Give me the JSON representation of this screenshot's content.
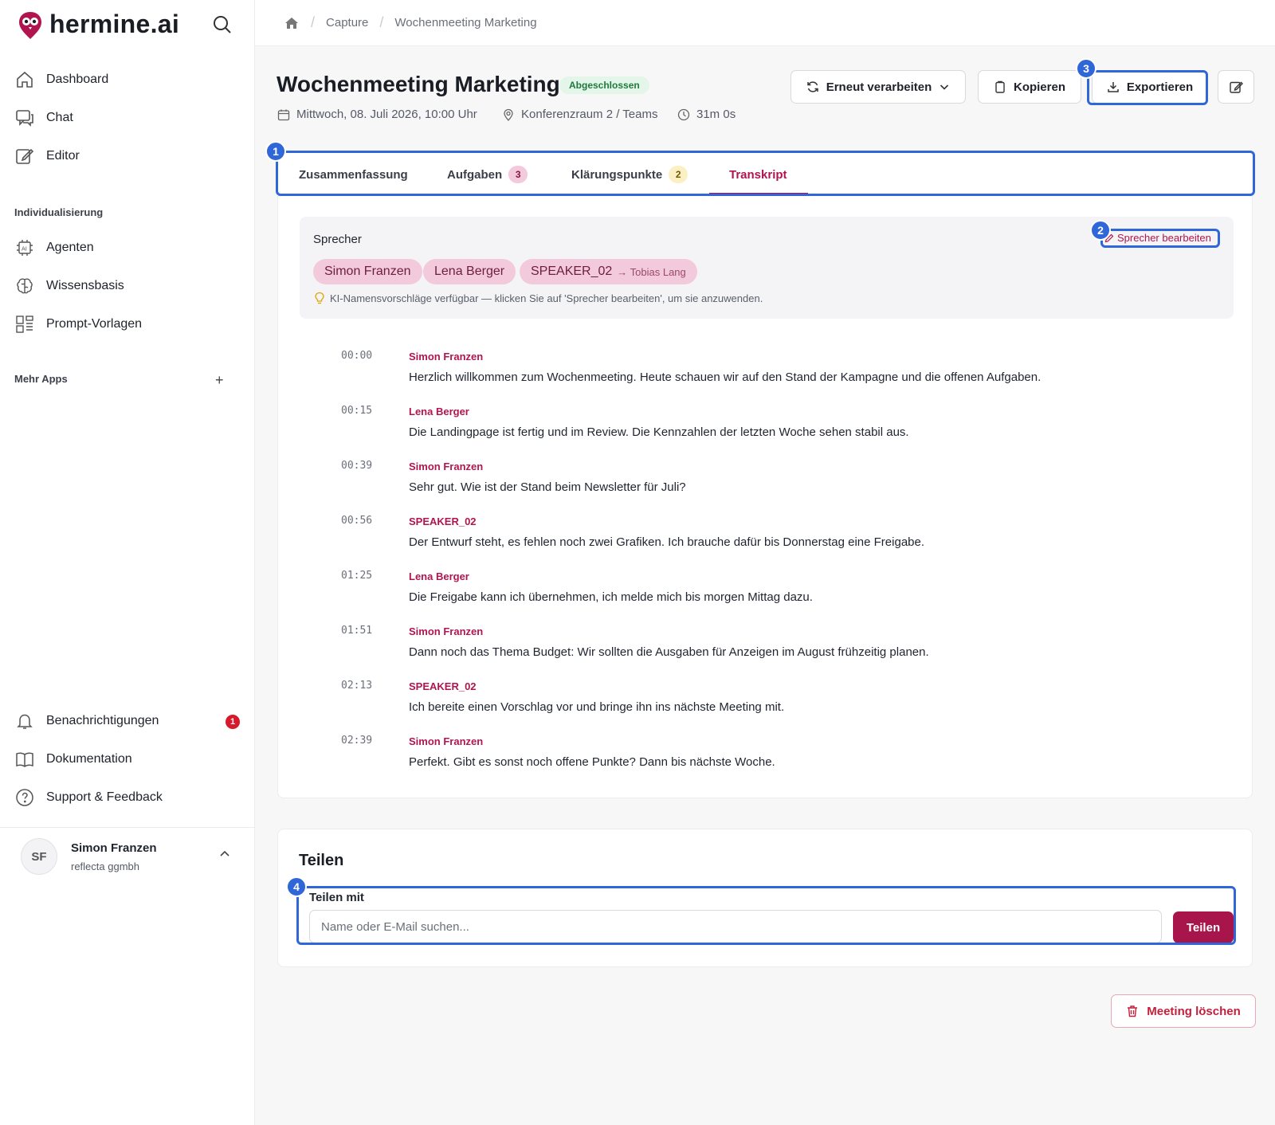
{
  "app": {
    "name": "hermine.ai"
  },
  "colors": {
    "brand": "#b0154f",
    "highlight": "#2f66d8",
    "status_bg": "#e4f6ea",
    "status_text": "#1e7a3c",
    "danger": "#c21f3d"
  },
  "sidebar": {
    "nav": [
      {
        "label": "Dashboard",
        "icon": "home-icon"
      },
      {
        "label": "Chat",
        "icon": "chat-icon"
      },
      {
        "label": "Editor",
        "icon": "edit-icon"
      }
    ],
    "section_customization": "Individualisierung",
    "custom_items": [
      {
        "label": "Agenten",
        "icon": "ai-chip-icon"
      },
      {
        "label": "Wissensbasis",
        "icon": "brain-icon"
      },
      {
        "label": "Prompt-Vorlagen",
        "icon": "template-icon"
      }
    ],
    "section_more_apps": "Mehr Apps",
    "bottom": [
      {
        "label": "Benachrichtigungen",
        "icon": "bell-icon",
        "badge": "1"
      },
      {
        "label": "Dokumentation",
        "icon": "book-icon"
      },
      {
        "label": "Support & Feedback",
        "icon": "help-icon"
      }
    ],
    "user": {
      "initials": "SF",
      "name": "Simon Franzen",
      "org": "reflecta ggmbh"
    }
  },
  "breadcrumbs": [
    "Capture",
    "Wochenmeeting Marketing"
  ],
  "meeting": {
    "title": "Wochenmeeting Marketing",
    "status": "Abgeschlossen",
    "date": "Mittwoch, 08. Juli 2026, 10:00 Uhr",
    "location": "Konferenzraum 2 / Teams",
    "duration": "31m 0s"
  },
  "actions": {
    "reprocess": "Erneut verarbeiten",
    "copy": "Kopieren",
    "export": "Exportieren"
  },
  "tabs": [
    {
      "label": "Zusammenfassung",
      "count": null
    },
    {
      "label": "Aufgaben",
      "count": "3"
    },
    {
      "label": "Klärungspunkte",
      "count": "2"
    },
    {
      "label": "Transkript",
      "count": null,
      "active": true
    }
  ],
  "speakers": {
    "label": "Sprecher",
    "edit_label": "Sprecher bearbeiten",
    "chips": [
      {
        "name": "Simon Franzen",
        "alias": ""
      },
      {
        "name": "Lena Berger",
        "alias": ""
      },
      {
        "name": "SPEAKER_02",
        "alias": "→ Tobias Lang"
      }
    ],
    "hint": "KI-Namensvorschläge verfügbar — klicken Sie auf 'Sprecher bearbeiten', um sie anzuwenden."
  },
  "transcript": [
    {
      "time": "00:00",
      "speaker": "Simon Franzen",
      "text": "Herzlich willkommen zum Wochenmeeting. Heute schauen wir auf den Stand der Kampagne und die offenen Aufgaben."
    },
    {
      "time": "00:15",
      "speaker": "Lena Berger",
      "text": "Die Landingpage ist fertig und im Review. Die Kennzahlen der letzten Woche sehen stabil aus."
    },
    {
      "time": "00:39",
      "speaker": "Simon Franzen",
      "text": "Sehr gut. Wie ist der Stand beim Newsletter für Juli?"
    },
    {
      "time": "00:56",
      "speaker": "SPEAKER_02",
      "text": "Der Entwurf steht, es fehlen noch zwei Grafiken. Ich brauche dafür bis Donnerstag eine Freigabe."
    },
    {
      "time": "01:25",
      "speaker": "Lena Berger",
      "text": "Die Freigabe kann ich übernehmen, ich melde mich bis morgen Mittag dazu."
    },
    {
      "time": "01:51",
      "speaker": "Simon Franzen",
      "text": "Dann noch das Thema Budget: Wir sollten die Ausgaben für Anzeigen im August frühzeitig planen."
    },
    {
      "time": "02:13",
      "speaker": "SPEAKER_02",
      "text": "Ich bereite einen Vorschlag vor und bringe ihn ins nächste Meeting mit."
    },
    {
      "time": "02:39",
      "speaker": "Simon Franzen",
      "text": "Perfekt. Gibt es sonst noch offene Punkte? Dann bis nächste Woche."
    }
  ],
  "share": {
    "title": "Teilen",
    "with_label": "Teilen mit",
    "placeholder": "Name oder E-Mail suchen...",
    "button": "Teilen"
  },
  "delete_label": "Meeting löschen",
  "markers": [
    "1",
    "2",
    "3",
    "4"
  ]
}
